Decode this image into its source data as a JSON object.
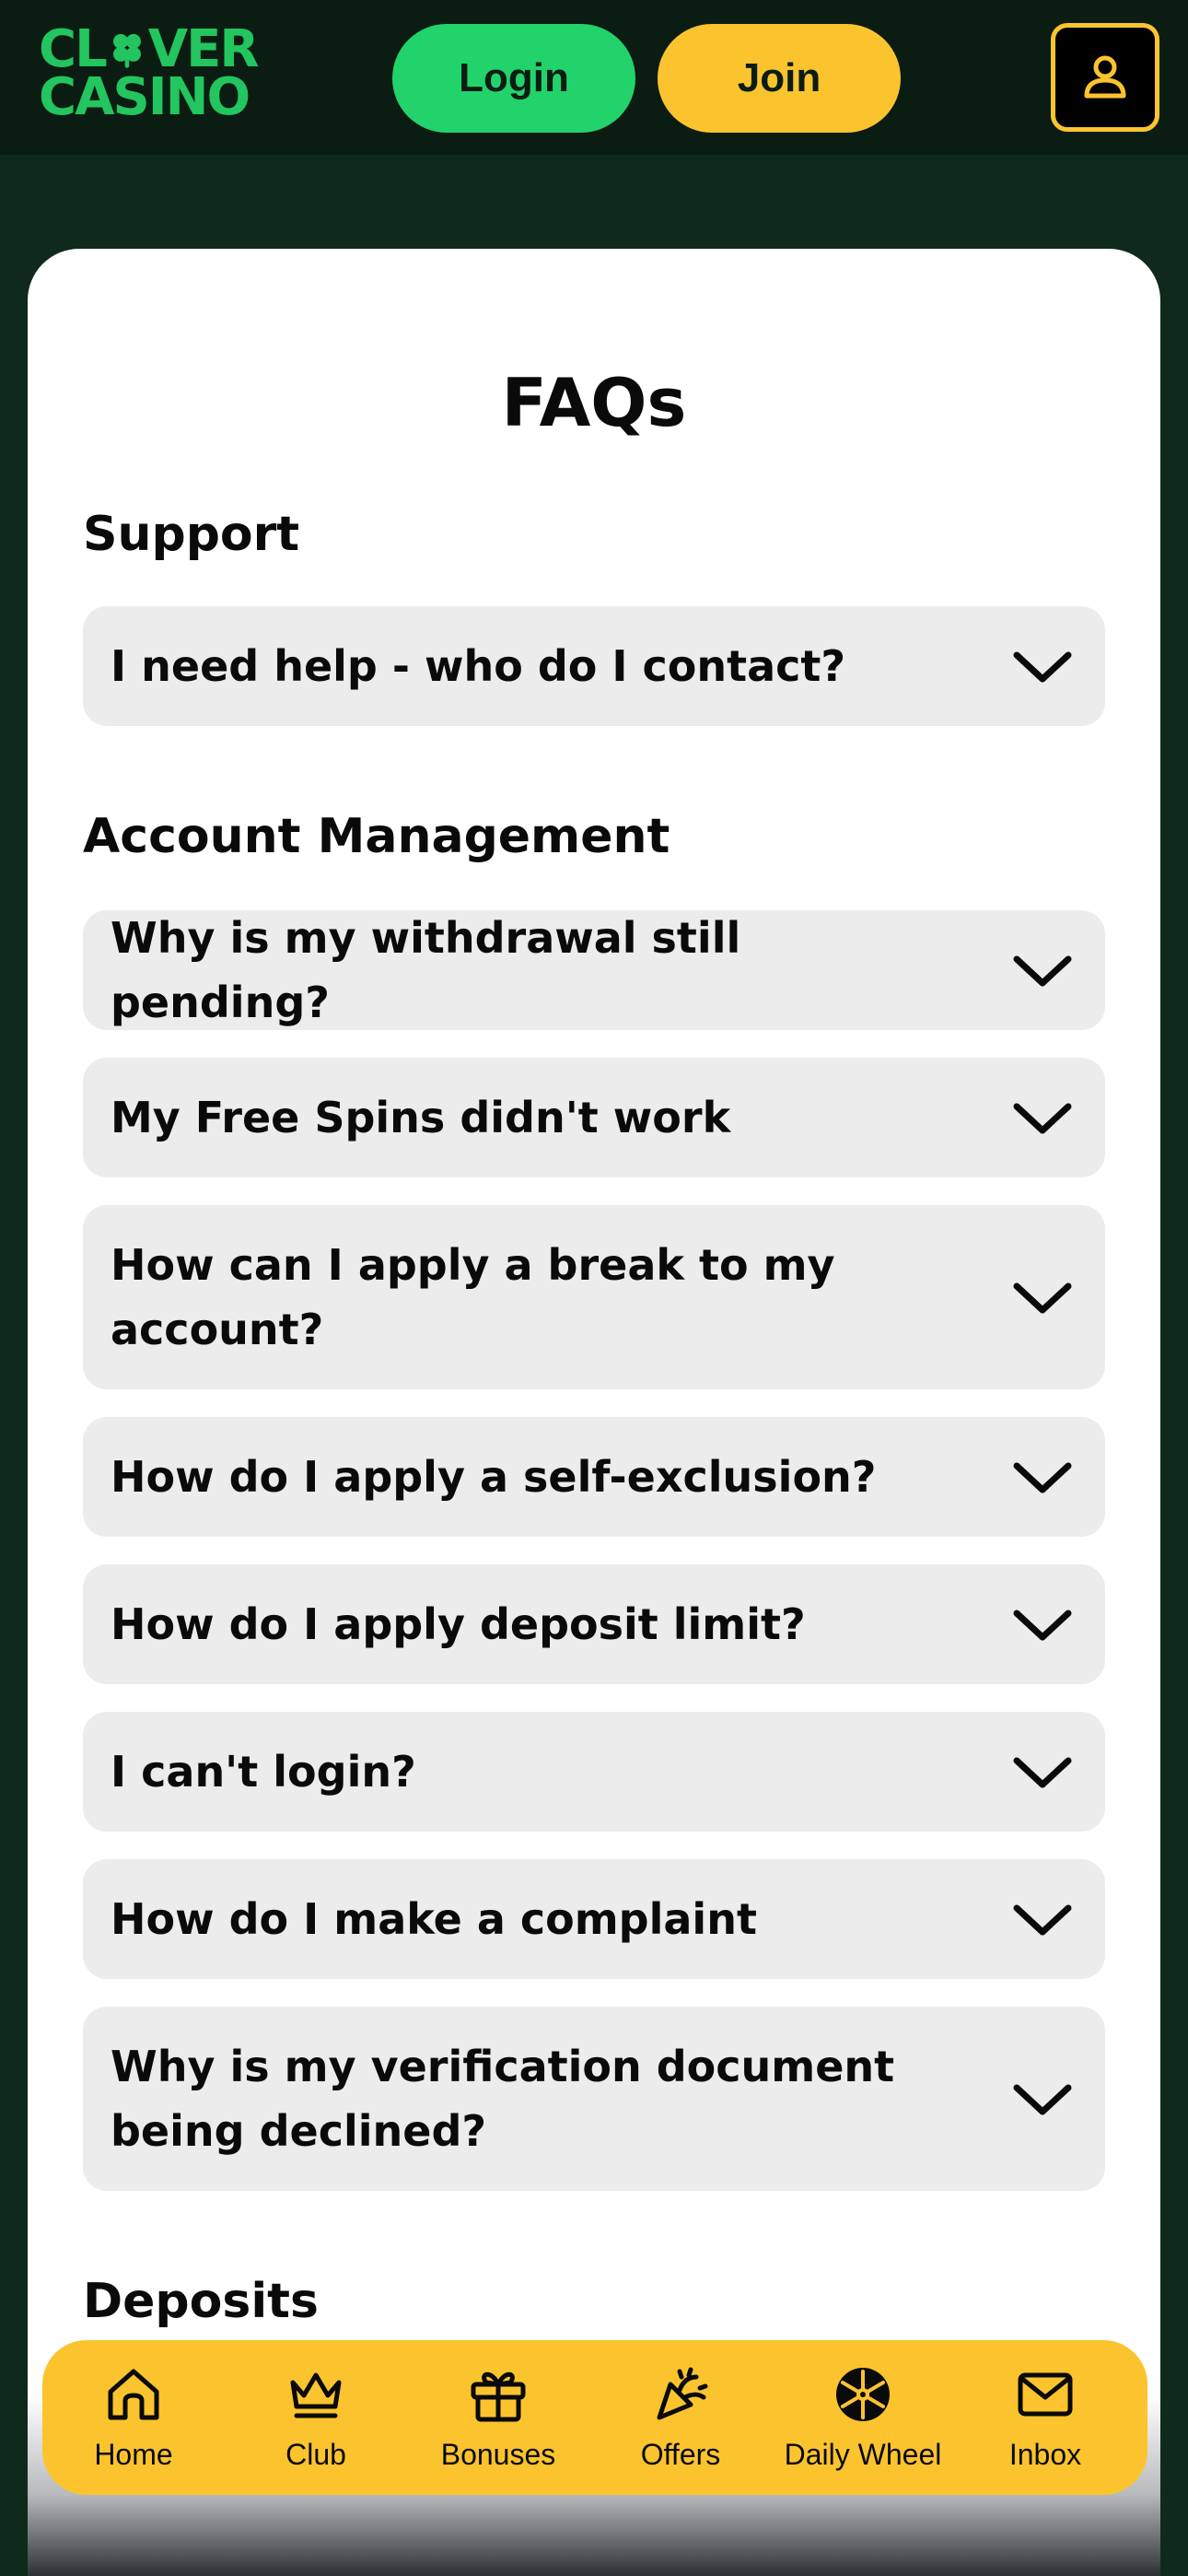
{
  "header": {
    "logo_line1": "CL VER",
    "logo_line2": "CASINO",
    "login_label": "Login",
    "join_label": "Join",
    "brand_green": "#22c55e",
    "brand_yellow": "#fbc42e"
  },
  "faq": {
    "title": "FAQs",
    "sections": [
      {
        "title": "Support",
        "items": [
          "I need help - who do I contact?"
        ]
      },
      {
        "title": "Account Management",
        "items": [
          "Why is my withdrawal still pending?",
          "My Free Spins didn't work",
          "How can I apply a break to my account?",
          "How do I apply a self-exclusion?",
          "How do I apply deposit limit?",
          "I can't login?",
          "How do I make a complaint",
          "Why is my verification document being declined?"
        ]
      },
      {
        "title": "Deposits",
        "items": []
      }
    ]
  },
  "bottom_nav": {
    "items": [
      {
        "label": "Home",
        "icon": "home-icon"
      },
      {
        "label": "Club",
        "icon": "crown-icon"
      },
      {
        "label": "Bonuses",
        "icon": "gift-icon"
      },
      {
        "label": "Offers",
        "icon": "party-popper-icon"
      },
      {
        "label": "Daily Wheel",
        "icon": "wheel-icon"
      },
      {
        "label": "Inbox",
        "icon": "mail-icon"
      }
    ]
  }
}
